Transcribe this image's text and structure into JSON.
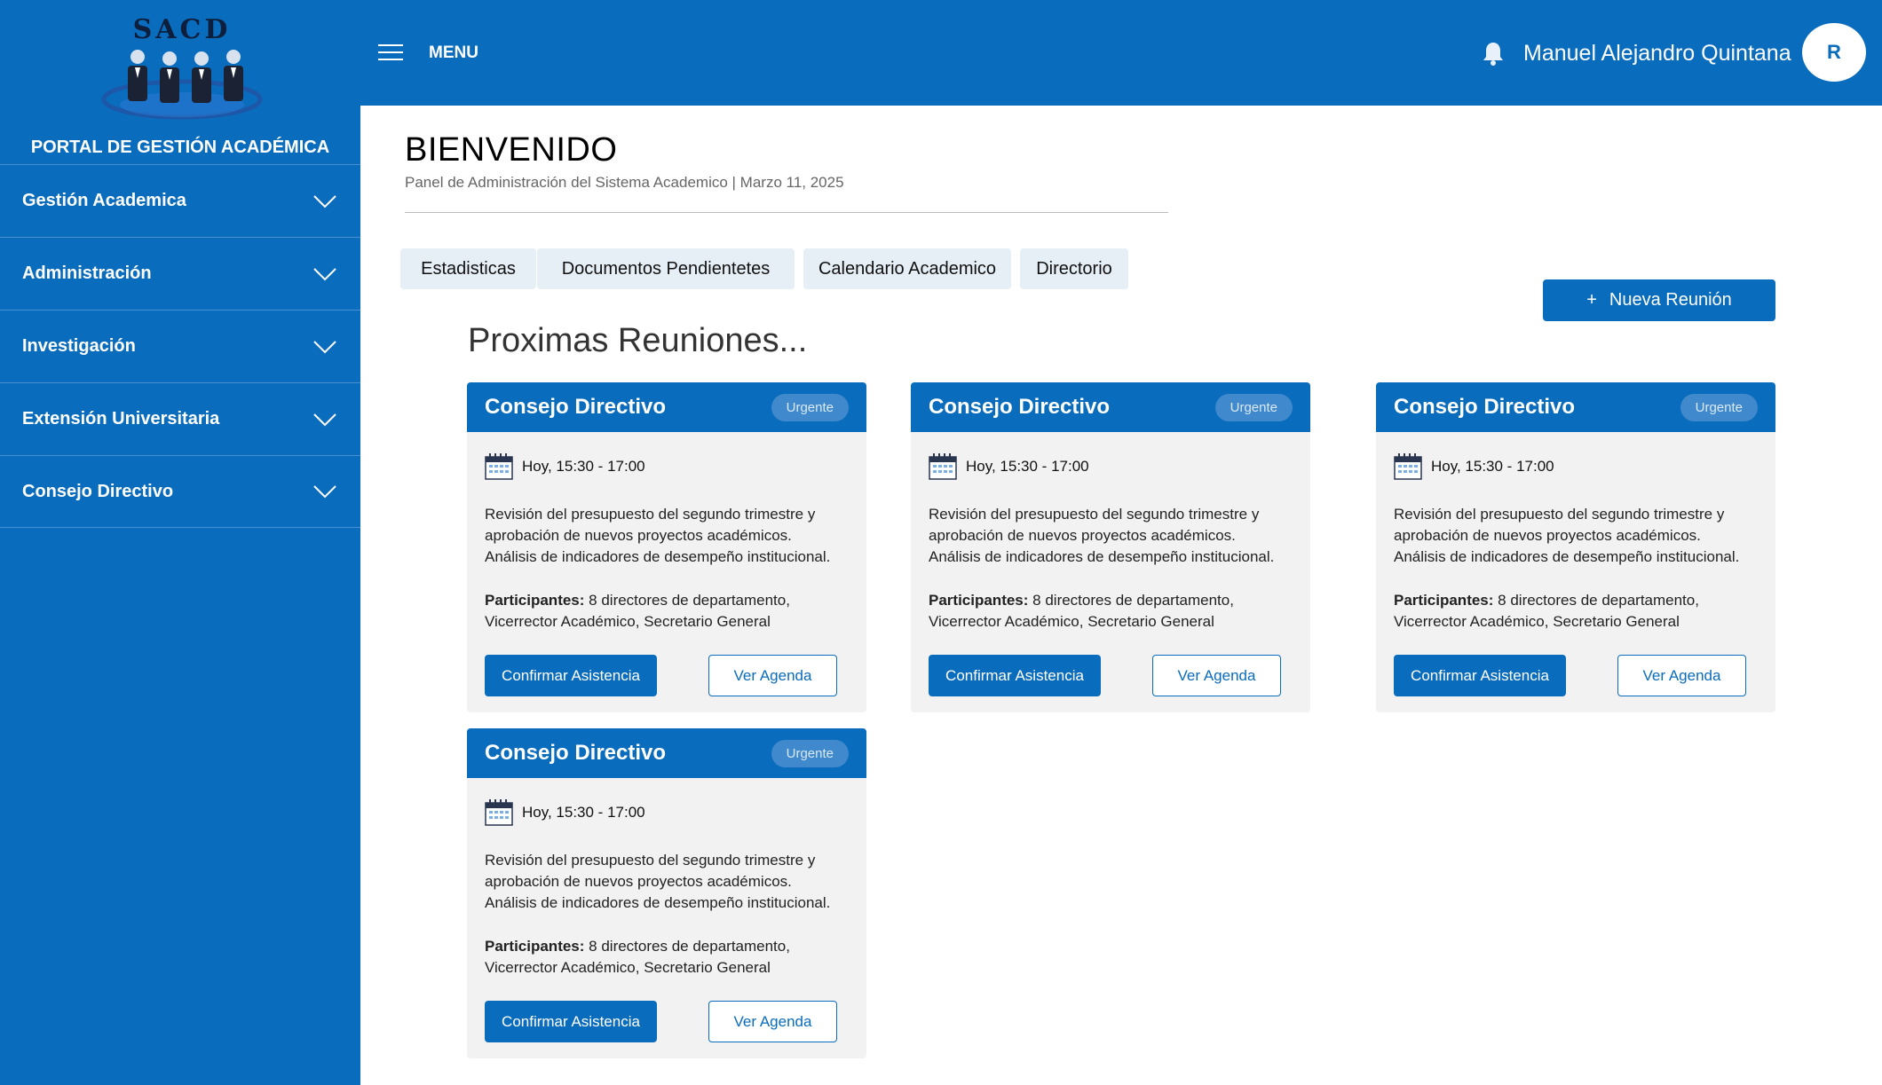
{
  "brand": {
    "logo_text": "SACD",
    "portal_title": "PORTAL DE GESTIÓN ACADÉMICA"
  },
  "sidebar": {
    "items": [
      {
        "label": "Gestión Academica",
        "icon": "chevron-down-icon"
      },
      {
        "label": "Administración",
        "icon": "chevron-down-icon"
      },
      {
        "label": "Investigación",
        "icon": "chevron-down-icon"
      },
      {
        "label": "Extensión Universitaria",
        "icon": "chevron-down-icon"
      },
      {
        "label": "Consejo Directivo",
        "icon": "chevron-down-icon"
      }
    ]
  },
  "header": {
    "menu_label": "MENU",
    "user_name": "Manuel Alejandro Quintana",
    "avatar_initial": "R"
  },
  "main": {
    "title": "BIENVENIDO",
    "subtitle": "Panel de Administración del Sistema  Academico | Marzo 11, 2025",
    "tabs": [
      {
        "label": "Estadisticas"
      },
      {
        "label": "Documentos Pendientetes"
      },
      {
        "label": "Calendario Academico"
      },
      {
        "label": "Directorio"
      }
    ],
    "new_meeting_label": "Nueva Reunión",
    "section_title": "Proximas Reuniones..."
  },
  "meetings": [
    {
      "title": "Consejo Directivo",
      "badge": "Urgente",
      "time": "Hoy, 15:30 - 17:00",
      "desc1": "Revisión del presupuesto del segundo trimestre y",
      "desc2": "aprobación de nuevos proyectos académicos.",
      "desc3": "Análisis de indicadores de desempeño institucional.",
      "participants_label": "Participantes:",
      "participants1": " 8 directores de departamento,",
      "participants2": "Vicerrector Académico, Secretario General",
      "confirm_label": "Confirmar Asistencia",
      "agenda_label": "Ver Agenda"
    },
    {
      "title": "Consejo Directivo",
      "badge": "Urgente",
      "time": "Hoy, 15:30 - 17:00",
      "desc1": "Revisión del presupuesto del segundo trimestre y",
      "desc2": "aprobación de nuevos proyectos académicos.",
      "desc3": "Análisis de indicadores de desempeño institucional.",
      "participants_label": "Participantes:",
      "participants1": " 8 directores de departamento,",
      "participants2": "Vicerrector Académico, Secretario General",
      "confirm_label": "Confirmar Asistencia",
      "agenda_label": "Ver Agenda"
    },
    {
      "title": "Consejo Directivo",
      "badge": "Urgente",
      "time": "Hoy, 15:30 - 17:00",
      "desc1": "Revisión del presupuesto del segundo trimestre y",
      "desc2": "aprobación de nuevos proyectos académicos.",
      "desc3": "Análisis de indicadores de desempeño institucional.",
      "participants_label": "Participantes:",
      "participants1": " 8 directores de departamento,",
      "participants2": "Vicerrector Académico, Secretario General",
      "confirm_label": "Confirmar Asistencia",
      "agenda_label": "Ver Agenda"
    },
    {
      "title": "Consejo Directivo",
      "badge": "Urgente",
      "time": "Hoy, 15:30 - 17:00",
      "desc1": "Revisión del presupuesto del segundo trimestre y",
      "desc2": "aprobación de nuevos proyectos académicos.",
      "desc3": "Análisis de indicadores de desempeño institucional.",
      "participants_label": "Participantes:",
      "participants1": " 8 directores de departamento,",
      "participants2": "Vicerrector Académico, Secretario General",
      "confirm_label": "Confirmar Asistencia",
      "agenda_label": "Ver Agenda"
    }
  ],
  "colors": {
    "primary": "#0a6cbd",
    "badge": "#3f89cc",
    "card_bg": "#f2f2f2",
    "tab_bg": "#e6eef6"
  }
}
